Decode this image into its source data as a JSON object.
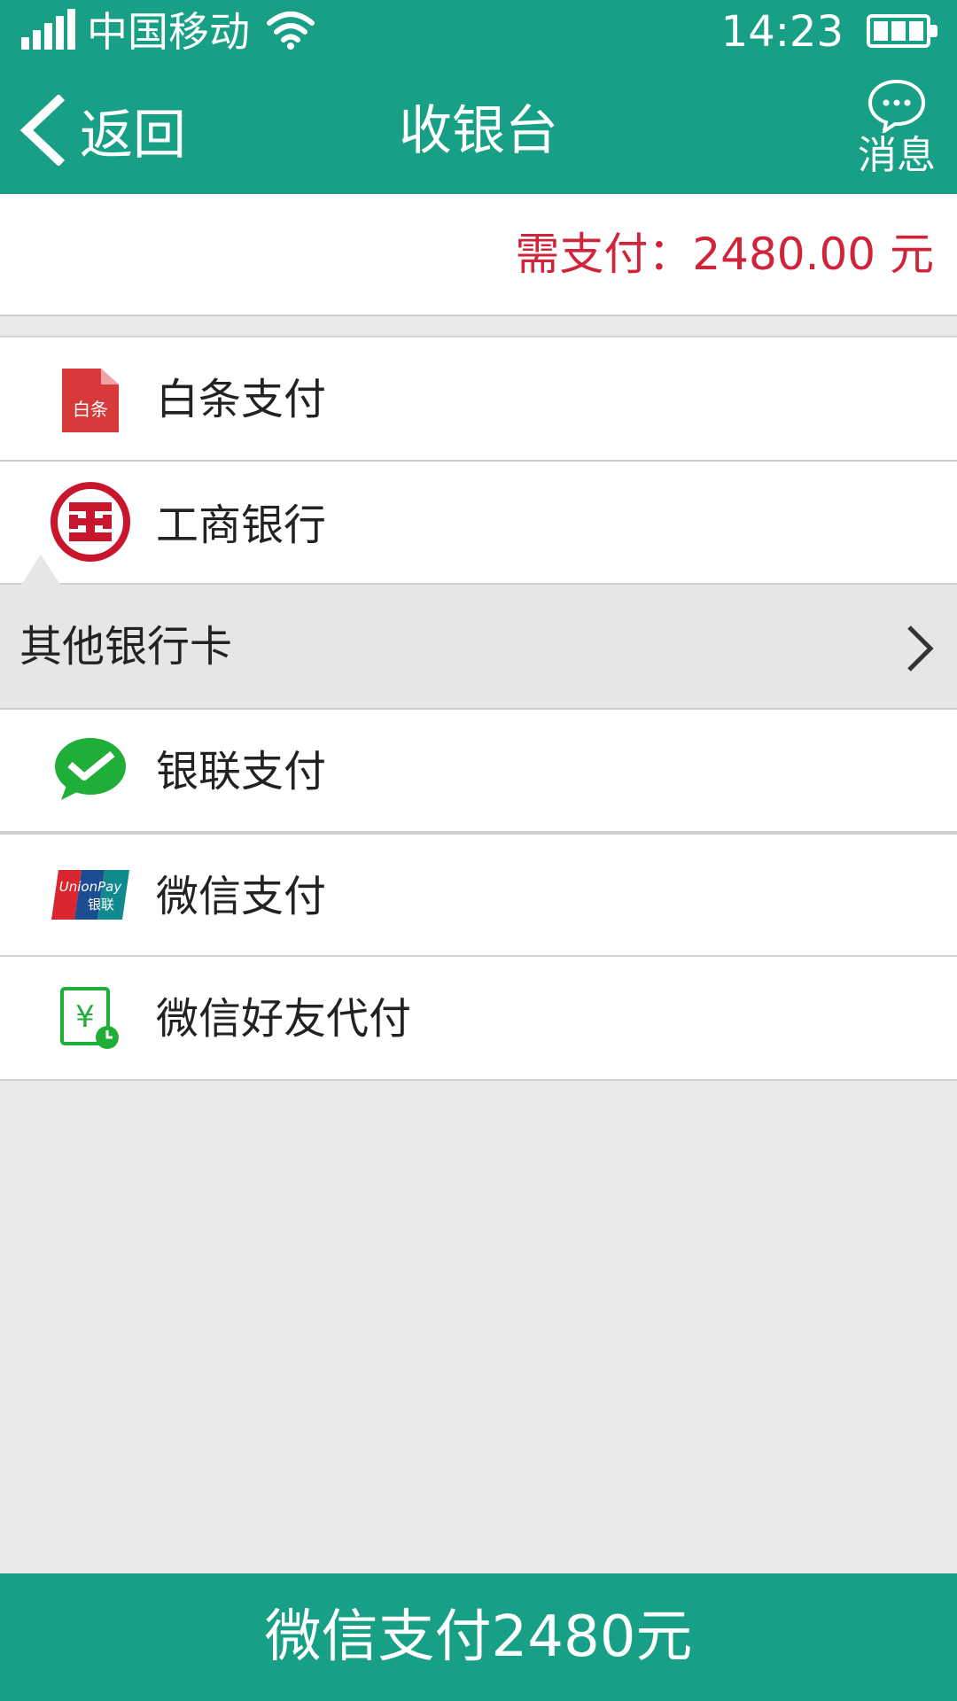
{
  "status_bar": {
    "carrier": "中国移动",
    "time": "14:23"
  },
  "nav": {
    "back_label": "返回",
    "title": "收银台",
    "message_label": "消息"
  },
  "amount": {
    "text": "需支付：2480.00 元"
  },
  "payment_methods": [
    {
      "label": "白条支付",
      "icon": "baitiao-icon",
      "icon_text": "白条"
    },
    {
      "label": "工商银行",
      "icon": "icbc-logo-icon"
    },
    {
      "label": "其他银行卡",
      "icon": "chevron-right-icon"
    },
    {
      "label": "银联支付",
      "icon": "wechat-icon"
    },
    {
      "label": "微信支付",
      "icon": "unionpay-icon",
      "icon_text": "UnionPay 银联"
    },
    {
      "label": "微信好友代付",
      "icon": "friend-pay-icon"
    }
  ],
  "pay_button": {
    "label": "微信支付2480元"
  },
  "colors": {
    "primary": "#17a085",
    "amount": "#d0243a",
    "background": "#e9e9e9"
  }
}
